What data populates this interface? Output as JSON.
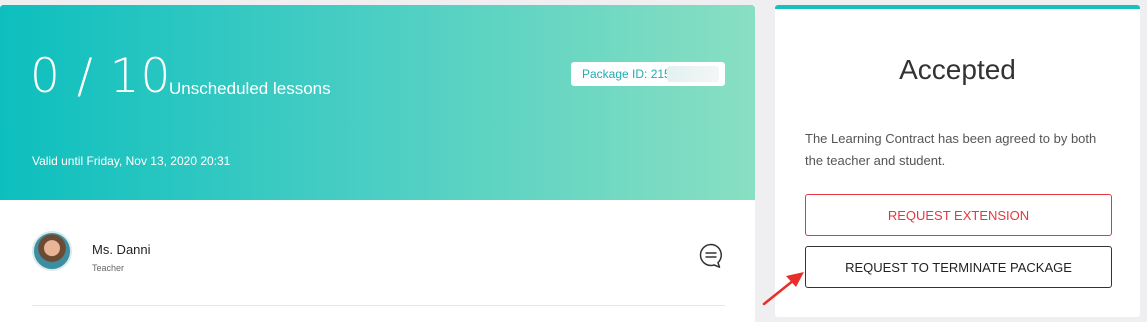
{
  "package": {
    "count": "0 / 10",
    "count_label": "Unscheduled lessons",
    "package_id_label": "Package ID: 215",
    "valid_prefix": "Valid until",
    "valid_date": "Friday, Nov 13, 2020 20:31"
  },
  "teacher": {
    "name": "Ms. Danni",
    "role": "Teacher"
  },
  "contract": {
    "status": "Accepted",
    "description": "The Learning Contract has been agreed to by both the teacher and student.",
    "extension_button": "REQUEST EXTENSION",
    "terminate_button": "REQUEST TO TERMINATE PACKAGE"
  },
  "colors": {
    "accent": "#17bfbd",
    "danger": "#e4383e",
    "annotation_arrow": "#e8302a"
  },
  "icons": {
    "message": "chat-bubble-icon",
    "annotation": "red-arrow-icon"
  }
}
